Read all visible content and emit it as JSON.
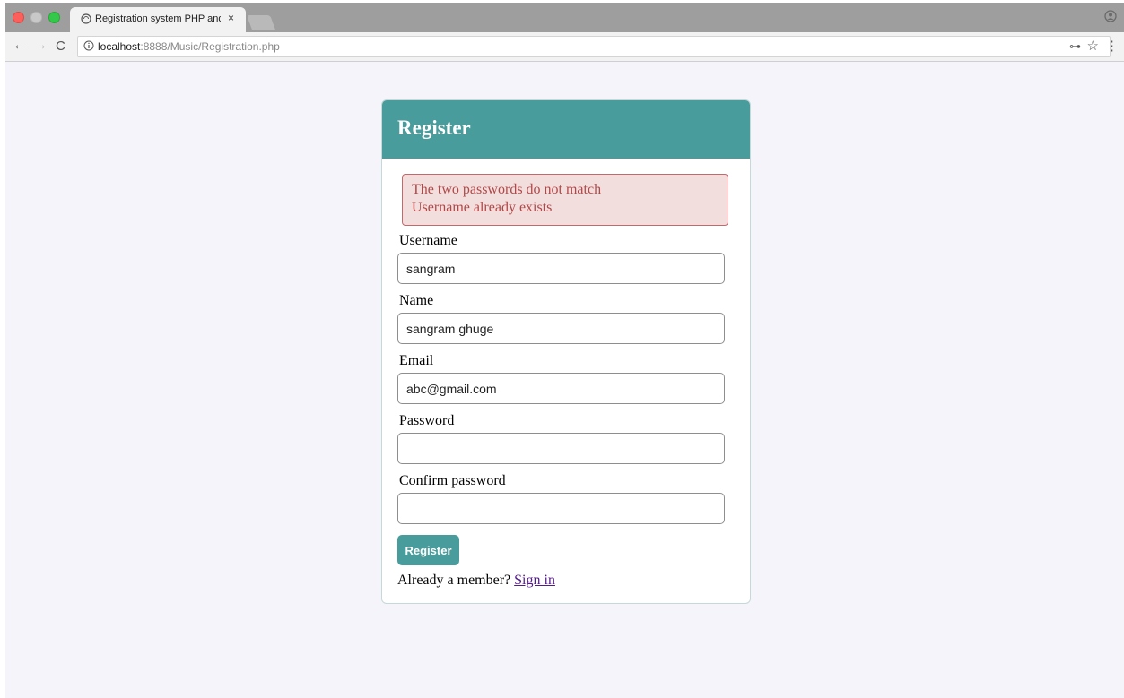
{
  "browser": {
    "tab_title": "Registration system PHP and M",
    "tab_close": "×",
    "url_host": "localhost",
    "url_rest": ":8888/Music/Registration.php",
    "back_glyph": "←",
    "forward_glyph": "→",
    "reload_glyph": "C",
    "key_glyph": "⊶",
    "star_glyph": "☆",
    "menu_glyph": "⋮"
  },
  "form": {
    "title": "Register",
    "errors": [
      "The two passwords do not match",
      "Username already exists"
    ],
    "fields": [
      {
        "label": "Username",
        "value": "sangram"
      },
      {
        "label": "Name",
        "value": "sangram ghuge"
      },
      {
        "label": "Email",
        "value": "abc@gmail.com"
      },
      {
        "label": "Password",
        "value": ""
      },
      {
        "label": "Confirm password",
        "value": ""
      }
    ],
    "submit_label": "Register",
    "member_text": "Already a member? ",
    "signin_label": "Sign in"
  },
  "colors": {
    "accent": "#489d9c",
    "error_bg": "#f3dede",
    "error_text": "#b14848"
  }
}
